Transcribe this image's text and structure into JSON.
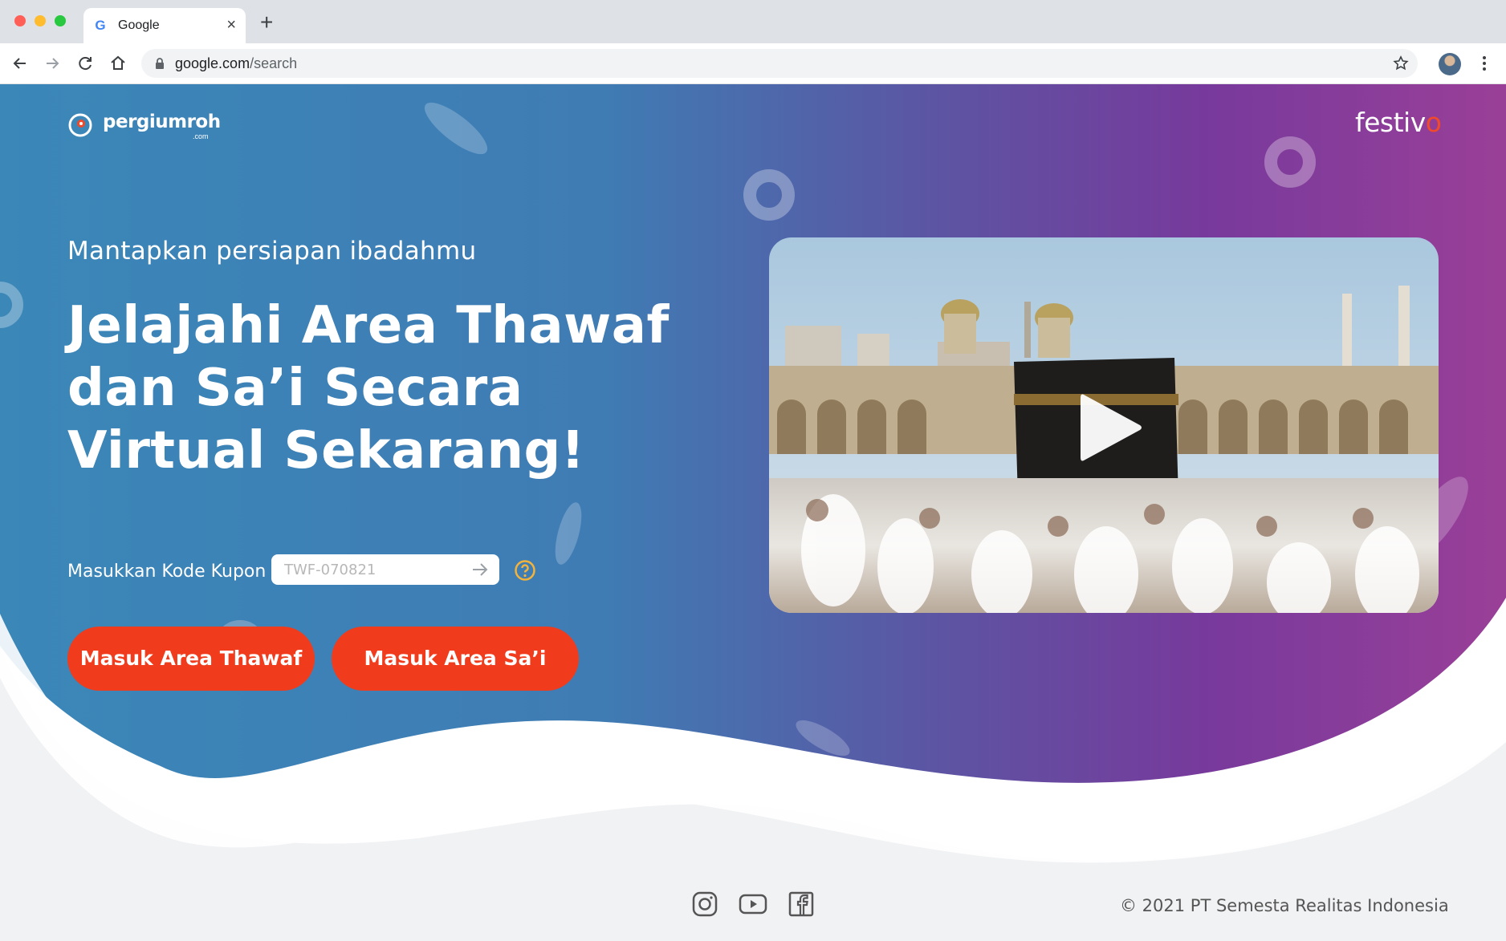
{
  "browser": {
    "tab_title": "Google",
    "tab_favicon": "G",
    "url_host": "google.com",
    "url_path": "/search",
    "icons": [
      "back-icon",
      "forward-icon",
      "reload-icon",
      "home-icon",
      "lock-icon",
      "star-icon",
      "menu-icon"
    ]
  },
  "header": {
    "logo_left": "pergiumroh",
    "logo_left_sub": ".com",
    "logo_right_text": "festiv",
    "logo_right_accent": "o"
  },
  "hero": {
    "subtitle": "Mantapkan persiapan ibadahmu",
    "headline_lines": [
      "Jelajahi Area Thawaf",
      "dan Sa’i Secara",
      "Virtual Sekarang!"
    ]
  },
  "coupon": {
    "label": "Masukkan Kode Kupon",
    "placeholder": "TWF-070821",
    "value": ""
  },
  "buttons": {
    "thawaf": "Masuk Area Thawaf",
    "sai": "Masuk Area Sa’i"
  },
  "video": {
    "play_icon": "play-icon"
  },
  "footer": {
    "social_icons": [
      "instagram-icon",
      "youtube-icon",
      "facebook-icon"
    ],
    "copyright": "© 2021 PT Semesta Realitas Indonesia"
  },
  "colors": {
    "gradient_start": "#3b87b8",
    "gradient_end": "#8e3f9c",
    "button": "#f03c1c",
    "help_icon": "#f2b33d"
  }
}
